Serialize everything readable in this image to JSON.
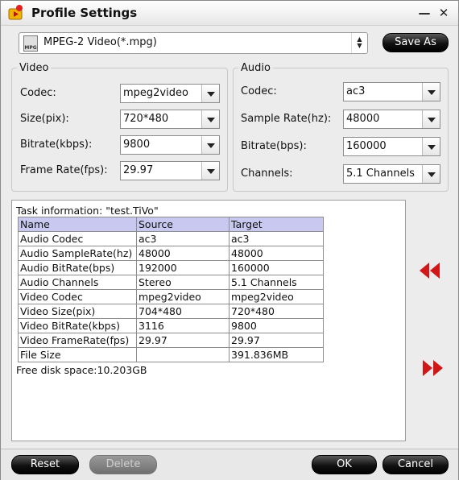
{
  "window": {
    "title": "Profile Settings"
  },
  "icons": {
    "app": "video-app-icon",
    "minimize": "minimize-icon",
    "close": "close-icon",
    "profile": "mpg-file-icon",
    "prev": "double-chevron-left-icon",
    "next": "double-chevron-right-icon"
  },
  "titlebar": {
    "minimize_glyph": "—",
    "close_glyph": "✕"
  },
  "profile": {
    "selected": "MPEG-2 Video(*.mpg)",
    "icon_label": "MPG",
    "save_as": "Save As",
    "spin_up": "▲",
    "spin_down": "▼"
  },
  "video": {
    "title": "Video",
    "codec_label": "Codec:",
    "codec": "mpeg2video",
    "size_label": "Size(pix):",
    "size": "720*480",
    "bitrate_label": "Bitrate(kbps):",
    "bitrate": "9800",
    "framerate_label": "Frame Rate(fps):",
    "framerate": "29.97"
  },
  "audio": {
    "title": "Audio",
    "codec_label": "Codec:",
    "codec": "ac3",
    "samplerate_label": "Sample Rate(hz):",
    "samplerate": "48000",
    "bitrate_label": "Bitrate(bps):",
    "bitrate": "160000",
    "channels_label": "Channels:",
    "channels": "5.1 Channels"
  },
  "task": {
    "info": "Task information: \"test.TiVo\"",
    "headers": [
      "Name",
      "Source",
      "Target"
    ],
    "rows": [
      [
        "Audio Codec",
        "ac3",
        "ac3"
      ],
      [
        "Audio SampleRate(hz)",
        "48000",
        "48000"
      ],
      [
        "Audio BitRate(bps)",
        "192000",
        "160000"
      ],
      [
        "Audio Channels",
        "Stereo",
        "5.1 Channels"
      ],
      [
        "Video Codec",
        "mpeg2video",
        "mpeg2video"
      ],
      [
        "Video Size(pix)",
        "704*480",
        "720*480"
      ],
      [
        "Video BitRate(kbps)",
        "3116",
        "9800"
      ],
      [
        "Video FrameRate(fps)",
        "29.97",
        "29.97"
      ],
      [
        "File Size",
        "",
        "391.836MB"
      ]
    ],
    "disk": "Free disk space:10.203GB"
  },
  "buttons": {
    "reset": "Reset",
    "delete": "Delete",
    "ok": "OK",
    "cancel": "Cancel"
  },
  "colors": {
    "header_row": "#c8c8f0",
    "arrow_red": "#d01818",
    "button_dark": "#111111"
  }
}
